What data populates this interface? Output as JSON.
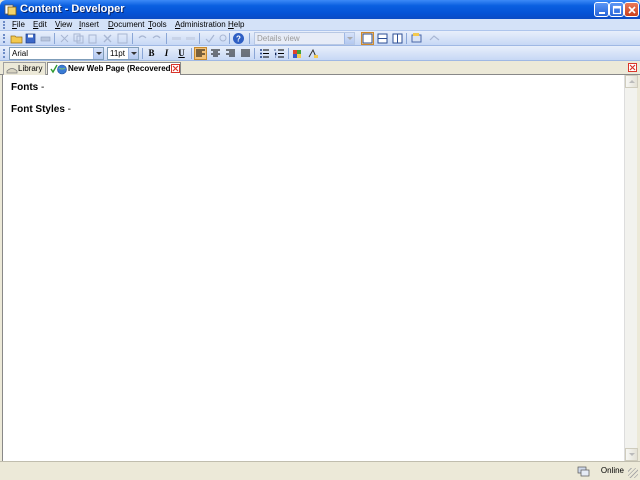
{
  "window": {
    "title": "Content - Developer",
    "controls": [
      "minimize",
      "maximize",
      "close"
    ]
  },
  "menu": {
    "items": [
      {
        "label": "File",
        "accel": "F",
        "rest": "ile"
      },
      {
        "label": "Edit",
        "accel": "E",
        "rest": "dit"
      },
      {
        "label": "View",
        "accel": "V",
        "rest": "iew"
      },
      {
        "label": "Insert",
        "accel": "I",
        "rest": "nsert"
      },
      {
        "label": "Document",
        "accel": "D",
        "rest": "ocument"
      },
      {
        "label": "Tools",
        "accel": "T",
        "rest": "ools"
      },
      {
        "label": "Administration",
        "accel": "A",
        "rest": "dministration"
      },
      {
        "label": "Help",
        "accel": "H",
        "rest": "elp"
      }
    ]
  },
  "toolbar1": {
    "view_select": "Details view"
  },
  "toolbar2": {
    "font_select": "Arial",
    "size_select": "11pt",
    "bold": "B",
    "italic": "I",
    "underline": "U"
  },
  "tabs": [
    {
      "label": "Library",
      "icon": "library-icon"
    },
    {
      "label": "New Web Page (Recovered)",
      "icon": "check-globe-icon",
      "active": true
    }
  ],
  "document": {
    "lines": [
      {
        "bold": "Fonts",
        "rest": " -"
      },
      {
        "bold": "Font Styles",
        "rest": " -"
      }
    ]
  },
  "status": {
    "text": "Online"
  },
  "colors": {
    "titlebar": "#0553d6",
    "menubar": "#d4e2f8",
    "active_format": "#f4c278",
    "close_red": "#d9352a"
  }
}
